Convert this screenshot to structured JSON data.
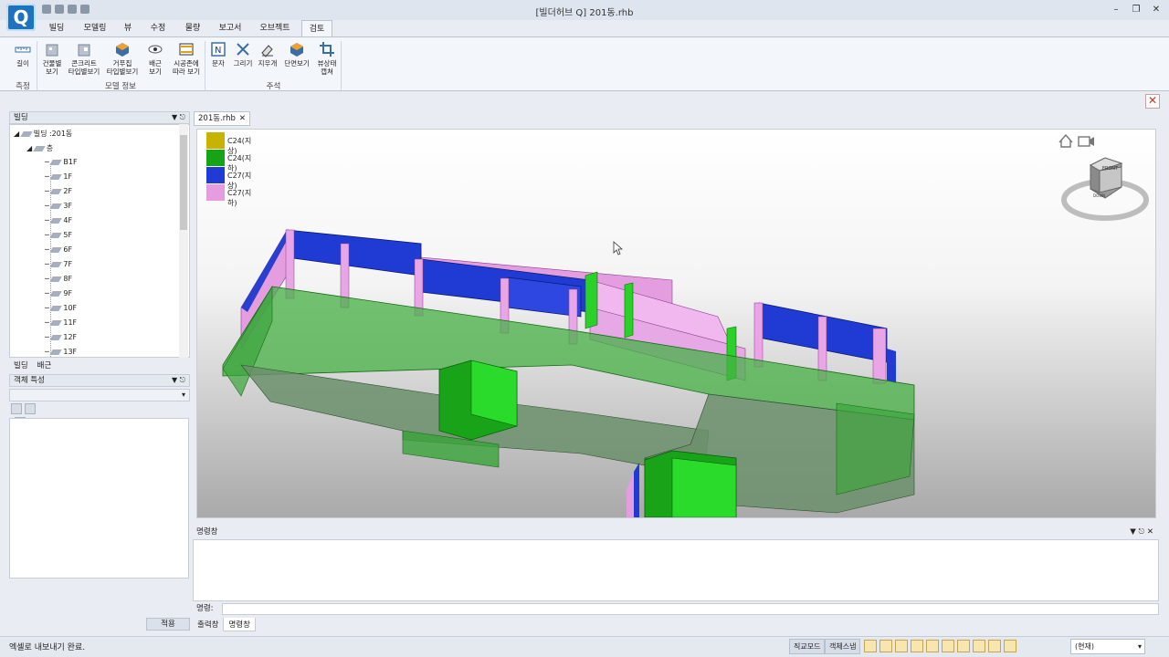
{
  "app": {
    "title": "[빌더허브 Q] 201동.rhb",
    "logo_letter": "Q",
    "colors": {
      "accent": "#1e73be",
      "close": "#c0392b"
    }
  },
  "menu_tabs": [
    "빌딩",
    "모델링",
    "뷰",
    "수정",
    "물량",
    "보고서",
    "오브젝트",
    "검토"
  ],
  "active_tab": "검토",
  "ribbon": {
    "buttons": [
      {
        "label1": "길이",
        "label2": "",
        "icon": "ruler-icon"
      },
      {
        "label1": "건물별",
        "label2": "보기",
        "icon": "building-view-icon"
      },
      {
        "label1": "콘크리트",
        "label2": "타입별보기",
        "icon": "concrete-type-icon"
      },
      {
        "label1": "거푸집",
        "label2": "타입별보기",
        "icon": "formwork-type-icon"
      },
      {
        "label1": "배근",
        "label2": "보기",
        "icon": "rebar-view-icon"
      },
      {
        "label1": "시공존에",
        "label2": "따라 보기",
        "icon": "construction-zone-icon"
      },
      {
        "label1": "문자",
        "label2": "",
        "icon": "text-icon"
      },
      {
        "label1": "그리기",
        "label2": "",
        "icon": "draw-icon"
      },
      {
        "label1": "지우개",
        "label2": "",
        "icon": "eraser-icon"
      },
      {
        "label1": "단면보기",
        "label2": "",
        "icon": "section-view-icon"
      },
      {
        "label1": "뷰상태",
        "label2": "캡쳐",
        "icon": "capture-icon"
      }
    ],
    "groups": [
      "측정",
      "모델 정보",
      "주석"
    ]
  },
  "left_panel": {
    "title": "빌딩",
    "tree_root": "빌딩 :201동",
    "tree_group": "층",
    "floors": [
      "B1F",
      "1F",
      "2F",
      "3F",
      "4F",
      "5F",
      "6F",
      "7F",
      "8F",
      "9F",
      "10F",
      "11F",
      "12F",
      "13F"
    ],
    "tabs": [
      "빌딩",
      "배근"
    ]
  },
  "property_panel": {
    "title": "객체 특성",
    "apply_label": "적용"
  },
  "document_tab": {
    "label": "201동.rhb"
  },
  "legend": [
    {
      "label": "C24(지상)",
      "color": "#c8b400"
    },
    {
      "label": "C24(지하)",
      "color": "#17a317"
    },
    {
      "label": "C27(지상)",
      "color": "#1f3bd4"
    },
    {
      "label": "C27(지하)",
      "color": "#e49ee0"
    }
  ],
  "viewcube": {
    "front": "FRONT",
    "down": "DOWN"
  },
  "command": {
    "title": "명령창",
    "prompt_label": "명령:",
    "value": "",
    "tabs": [
      "출력창",
      "명령창"
    ],
    "active_tab": "명령창"
  },
  "status": {
    "message": "엑셀로 내보내기 완료.",
    "buttons": [
      "직교모드",
      "객체스냅"
    ],
    "combo": "(현재)"
  }
}
